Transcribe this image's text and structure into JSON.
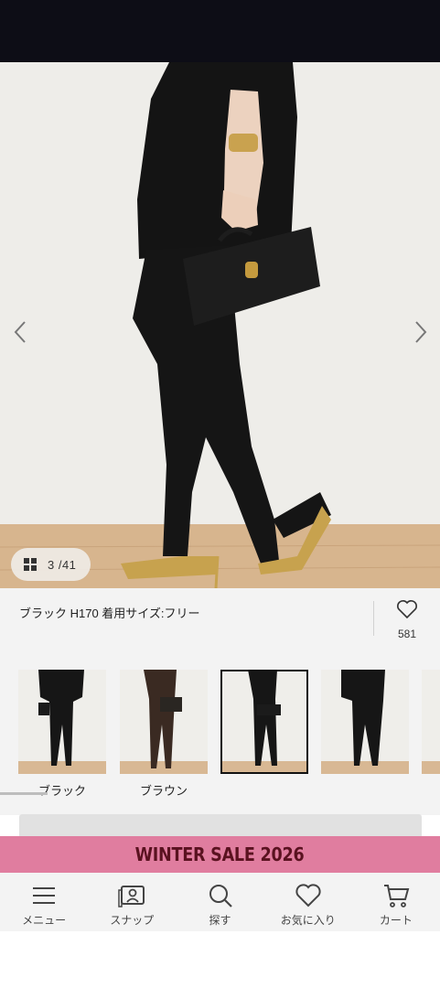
{
  "product": {
    "image_counter": "3 /41",
    "caption": "ブラック H170 着用サイズ:フリー",
    "favorite_count": "581"
  },
  "color_variants": [
    {
      "label": "ブラック"
    },
    {
      "label": "ブラウン"
    },
    {
      "label": ""
    },
    {
      "label": ""
    }
  ],
  "banner": {
    "text": "WINTER SALE 2026",
    "color": "#e07d9f"
  },
  "tabbar": {
    "items": [
      {
        "label": "メニュー",
        "icon": "menu-icon"
      },
      {
        "label": "スナップ",
        "icon": "snap-icon"
      },
      {
        "label": "探す",
        "icon": "search-icon"
      },
      {
        "label": "お気に入り",
        "icon": "heart-icon"
      },
      {
        "label": "カート",
        "icon": "cart-icon"
      }
    ]
  }
}
